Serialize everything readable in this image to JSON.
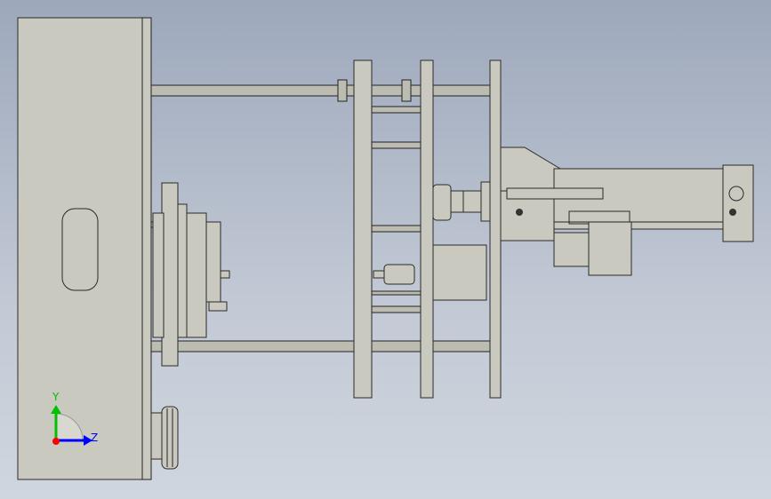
{
  "viewport": {
    "background_top": "#9da8bb",
    "background_bottom": "#d0d6de"
  },
  "triad": {
    "y_label": "Y",
    "z_label": "Z",
    "y_color": "#00c000",
    "z_color": "#0000ff",
    "origin_color": "#ff0000"
  }
}
